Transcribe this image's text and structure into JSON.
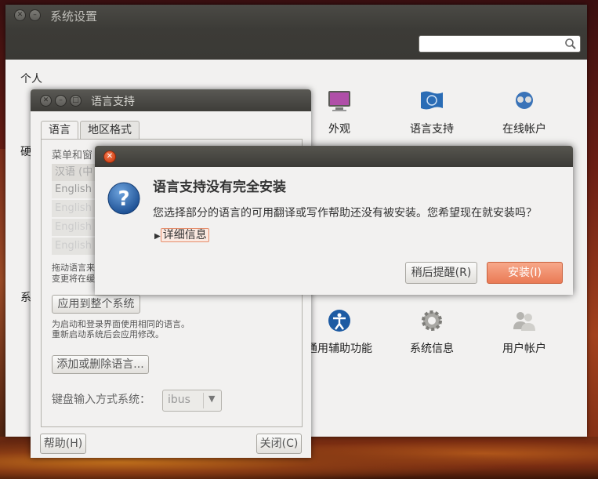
{
  "main_window": {
    "title": "系统设置",
    "search": {
      "value": "",
      "placeholder": ""
    },
    "sections": {
      "personal": "个人",
      "hardware": "硬",
      "system": "系"
    },
    "items": [
      {
        "label": "外观",
        "icon": "monitor-icon"
      },
      {
        "label": "语言支持",
        "icon": "language-flag-icon"
      },
      {
        "label": "在线帐户",
        "icon": "online-accounts-icon"
      },
      {
        "label": "通用辅助功能",
        "icon": "accessibility-icon"
      },
      {
        "label": "系统信息",
        "icon": "gear-icon"
      },
      {
        "label": "用户帐户",
        "icon": "users-icon"
      }
    ]
  },
  "language_window": {
    "title": "语言支持",
    "tabs": [
      "语言",
      "地区格式"
    ],
    "menu_label_partial": "菜单和窗",
    "language_list": [
      "汉语 (中",
      "English",
      "English",
      "English",
      "English"
    ],
    "drag_hint_line1": "拖动语言来",
    "drag_hint_line2": "变更将在缓",
    "apply_button": "应用到整个系统",
    "apply_note_line1": "为启动和登录界面使用相同的语言。",
    "apply_note_line2": "重新启动系统后会应用修改。",
    "add_remove_button": "添加或删除语言...",
    "keyboard_label": "键盘输入方式系统：",
    "keyboard_value": "ibus",
    "help_button": "帮助(H)",
    "close_button": "关闭(C)"
  },
  "dialog": {
    "heading": "语言支持没有完全安装",
    "body": "您选择部分的语言的可用翻译或写作帮助还没有被安装。您希望现在就安装吗？",
    "details_label": "详细信息",
    "later_button": "稍后提醒(R)",
    "install_button": "安装(I)"
  },
  "colors": {
    "accent": "#ea7a55",
    "titlebar": "#3c3b37",
    "window_bg": "#f2f1f0"
  }
}
